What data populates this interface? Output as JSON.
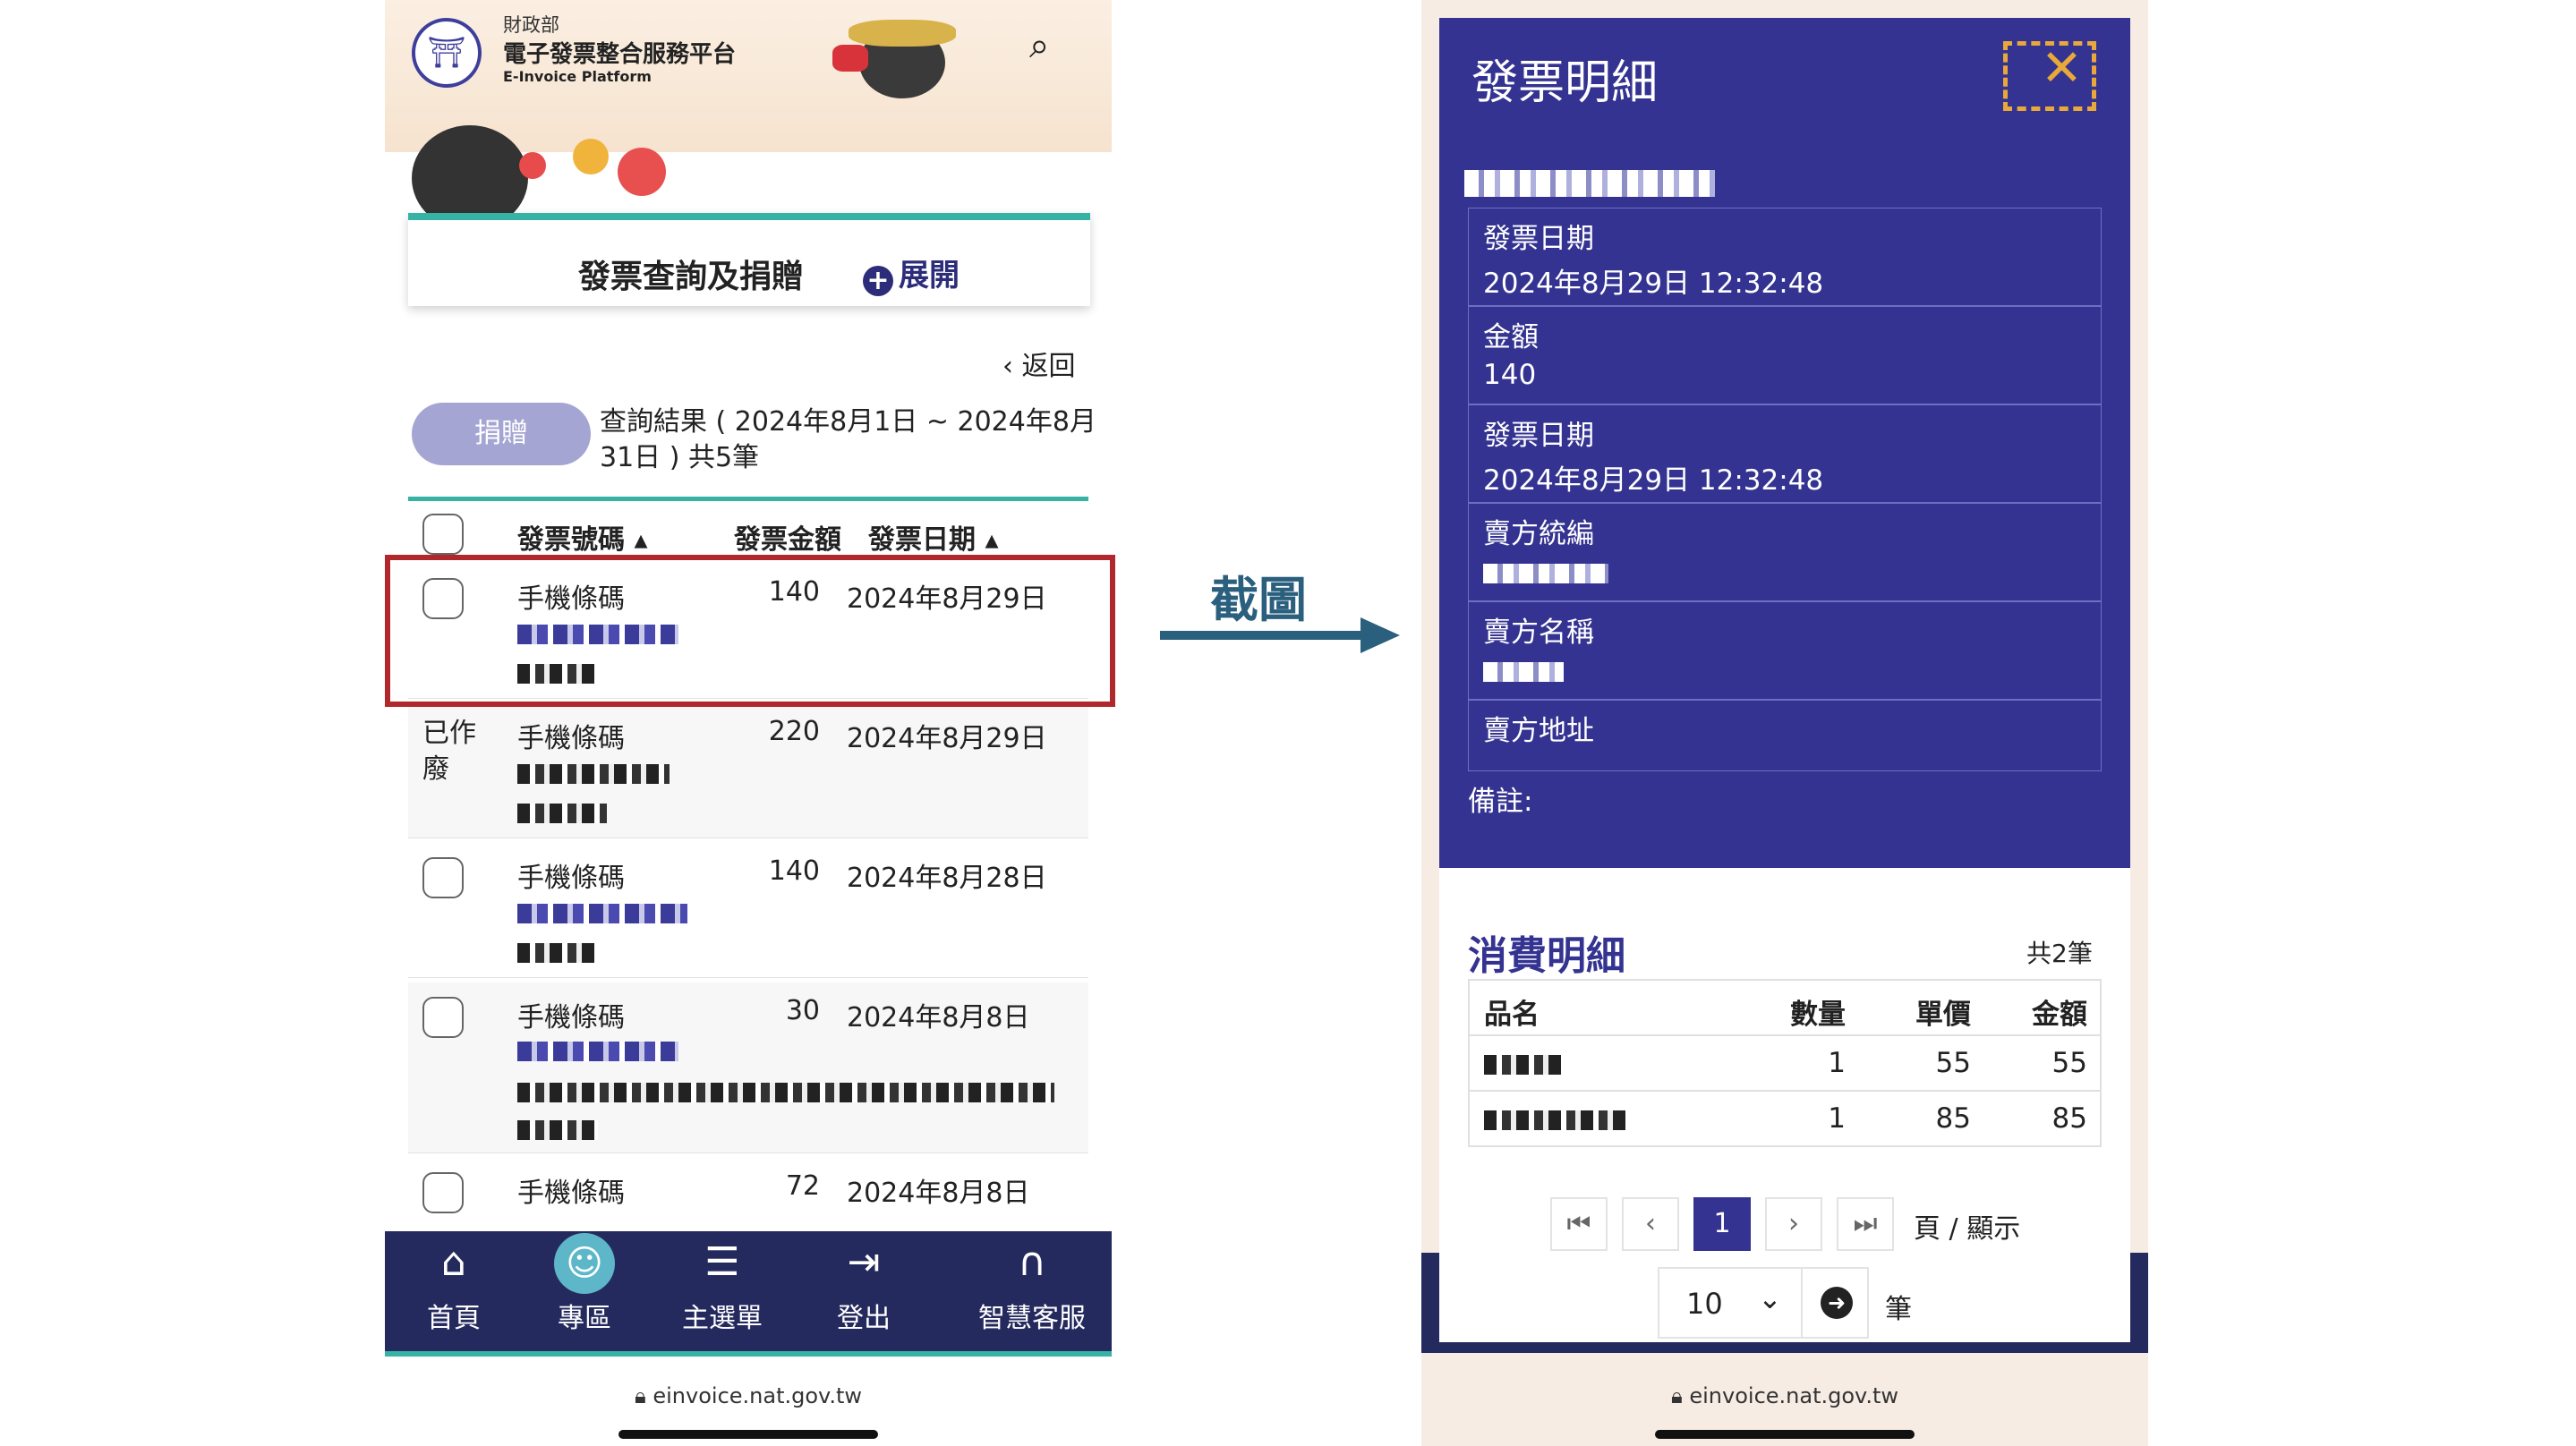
{
  "left": {
    "header": {
      "ministry": "財政部",
      "platform": "電子發票整合服務平台",
      "platform_en": "E-Invoice Platform",
      "search_icon": "search-icon"
    },
    "banner": {
      "title": "發票查詢及捐贈",
      "expand": "展開"
    },
    "back": "返回",
    "donate_button": "捐贈",
    "result_text": "查詢結果 ( 2024年8月1日 ~ 2024年8月31日 ) 共5筆",
    "table": {
      "headers": [
        "發票號碼",
        "發票金額",
        "發票日期"
      ],
      "rows": [
        {
          "status": "",
          "type": "手機條碼",
          "amount": "140",
          "date": "2024年8月29日"
        },
        {
          "status": "已作廢",
          "type": "手機條碼",
          "amount": "220",
          "date": "2024年8月29日"
        },
        {
          "status": "",
          "type": "手機條碼",
          "amount": "140",
          "date": "2024年8月28日"
        },
        {
          "status": "",
          "type": "手機條碼",
          "amount": "30",
          "date": "2024年8月8日"
        },
        {
          "status": "",
          "type": "手機條碼",
          "amount": "72",
          "date": "2024年8月8日"
        }
      ]
    },
    "nav": [
      {
        "icon": "home-icon",
        "label": "首頁"
      },
      {
        "icon": "people-icon",
        "label": "專區"
      },
      {
        "icon": "menu-icon",
        "label": "主選單"
      },
      {
        "icon": "logout-icon",
        "label": "登出"
      },
      {
        "icon": "headset-icon",
        "label": "智慧客服"
      }
    ],
    "url": "einvoice.nat.gov.tw"
  },
  "middle": {
    "label": "截圖"
  },
  "right": {
    "title": "發票明細",
    "fields": [
      {
        "label": "發票日期",
        "value": "2024年8月29日 12:32:48"
      },
      {
        "label": "金額",
        "value": "140"
      },
      {
        "label": "發票日期",
        "value": "2024年8月29日 12:32:48"
      },
      {
        "label": "賣方統編",
        "value": ""
      },
      {
        "label": "賣方名稱",
        "value": ""
      },
      {
        "label": "賣方地址",
        "value": ""
      }
    ],
    "note": "備註:",
    "consumption": {
      "title": "消費明細",
      "count": "共2筆",
      "headers": [
        "品名",
        "數量",
        "單價",
        "金額"
      ],
      "rows": [
        {
          "qty": "1",
          "price": "55",
          "amount": "55"
        },
        {
          "qty": "1",
          "price": "85",
          "amount": "85"
        }
      ]
    },
    "pagination": {
      "current": "1",
      "page_label": "頁",
      "sep": "/",
      "show_label": "顯示",
      "per_page": "10",
      "unit": "筆"
    },
    "url": "einvoice.nat.gov.tw"
  },
  "colors": {
    "navy": "#343391",
    "teal": "#37b3a6",
    "red_highlight": "#b0272c",
    "arrow": "#2b5f7e"
  }
}
